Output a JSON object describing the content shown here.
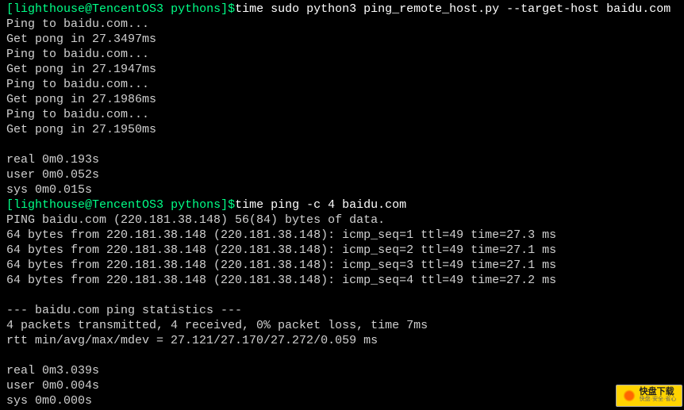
{
  "prompt1": {
    "open": "[",
    "userhost": "lighthouse@TencentOS3",
    "space": " ",
    "path": "pythons",
    "close": "]",
    "dollar": "$"
  },
  "command1": "time sudo python3 ping_remote_host.py --target-host baidu.com",
  "output1": [
    "Ping to baidu.com...",
    "Get pong in 27.3497ms",
    "Ping to baidu.com...",
    "Get pong in 27.1947ms",
    "Ping to baidu.com...",
    "Get pong in 27.1986ms",
    "Ping to baidu.com...",
    "Get pong in 27.1950ms",
    "",
    "real    0m0.193s",
    "user    0m0.052s",
    "sys     0m0.015s"
  ],
  "prompt2": {
    "open": "[",
    "userhost": "lighthouse@TencentOS3",
    "space": " ",
    "path": "pythons",
    "close": "]",
    "dollar": "$"
  },
  "command2": "time ping -c 4 baidu.com",
  "output2": [
    "PING baidu.com (220.181.38.148) 56(84) bytes of data.",
    "64 bytes from 220.181.38.148 (220.181.38.148): icmp_seq=1 ttl=49 time=27.3 ms",
    "64 bytes from 220.181.38.148 (220.181.38.148): icmp_seq=2 ttl=49 time=27.1 ms",
    "64 bytes from 220.181.38.148 (220.181.38.148): icmp_seq=3 ttl=49 time=27.1 ms",
    "64 bytes from 220.181.38.148 (220.181.38.148): icmp_seq=4 ttl=49 time=27.2 ms",
    "",
    "--- baidu.com ping statistics ---",
    "4 packets transmitted, 4 received, 0% packet loss, time 7ms",
    "rtt min/avg/max/mdev = 27.121/27.170/27.272/0.059 ms",
    "",
    "real    0m3.039s",
    "user    0m0.004s",
    "sys     0m0.000s"
  ],
  "watermark": {
    "title": "快盘下载",
    "sub": "快盘·安全·省心"
  }
}
